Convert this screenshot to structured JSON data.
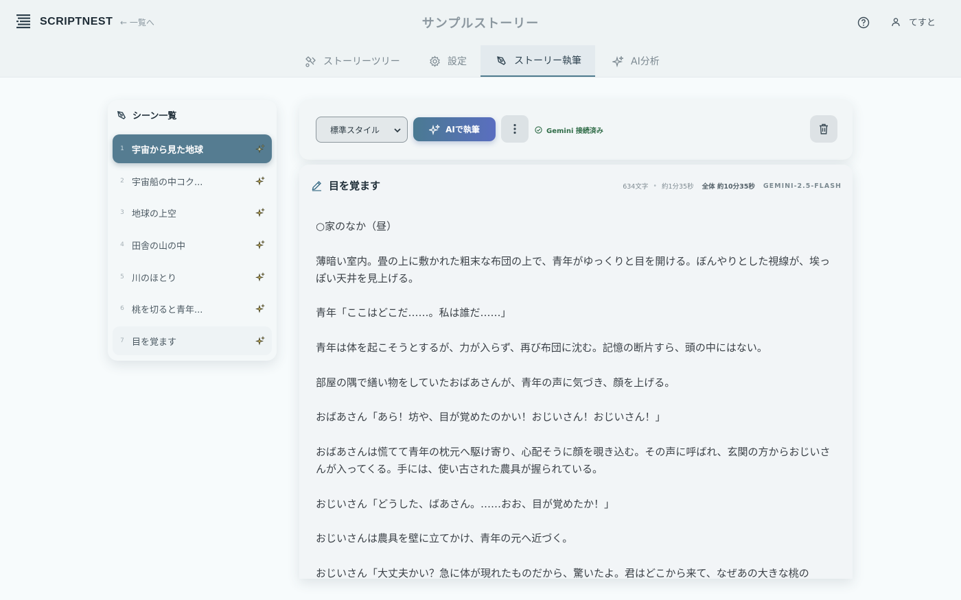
{
  "app": {
    "brand": "SCRIPTNEST",
    "back_link": "← 一覧へ",
    "page_title": "サンプルストーリー",
    "user_name": "てすと"
  },
  "tabs": [
    {
      "label": "ストーリーツリー",
      "icon": "tree-icon"
    },
    {
      "label": "設定",
      "icon": "gear-icon"
    },
    {
      "label": "ストーリー執筆",
      "icon": "pen-icon",
      "active": true
    },
    {
      "label": "AI分析",
      "icon": "sparkle-icon"
    }
  ],
  "sidebar": {
    "title": "シーン一覧",
    "scenes": [
      {
        "num": "1",
        "label": "宇宙から見た地球",
        "active": true
      },
      {
        "num": "2",
        "label": "宇宙船の中コク..."
      },
      {
        "num": "3",
        "label": "地球の上空"
      },
      {
        "num": "4",
        "label": "田舎の山の中"
      },
      {
        "num": "5",
        "label": "川のほとり"
      },
      {
        "num": "6",
        "label": "桃を切ると青年..."
      },
      {
        "num": "7",
        "label": "目を覚ます"
      }
    ]
  },
  "toolbar": {
    "style_value": "標準スタイル",
    "ai_button": "AIで執筆",
    "status": "Gemini 接続済み"
  },
  "editor": {
    "title": "目を覚ます",
    "char_count": "634文字",
    "duration": "約1分35秒",
    "total": "全体 約10分35秒",
    "model": "GEMINI-2.5-FLASH",
    "paragraphs": [
      "○家のなか（昼）",
      "薄暗い室内。畳の上に敷かれた粗末な布団の上で、青年がゆっくりと目を開ける。ぼんやりとした視線が、埃っぽい天井を見上げる。",
      "青年「ここはどこだ……。私は誰だ……」",
      "青年は体を起こそうとするが、力が入らず、再び布団に沈む。記憶の断片すら、頭の中にはない。",
      "部屋の隅で繕い物をしていたおばあさんが、青年の声に気づき、顔を上げる。",
      "おばあさん「あら！坊や、目が覚めたのかい！おじいさん！おじいさん！」",
      "おばあさんは慌てて青年の枕元へ駆け寄り、心配そうに顔を覗き込む。その声に呼ばれ、玄関の方からおじいさんが入ってくる。手には、使い古された農具が握られている。",
      "おじいさん「どうした、ばあさん。……おお、目が覚めたか！」",
      "おじいさんは農具を壁に立てかけ、青年の元へ近づく。",
      "おじいさん「大丈夫かい？急に体が現れたものだから、驚いたよ。君はどこから来て、なぜあの大きな桃の"
    ]
  }
}
